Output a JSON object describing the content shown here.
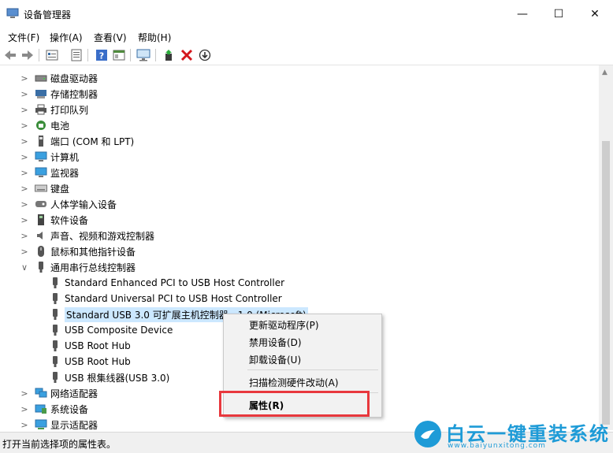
{
  "window": {
    "title": "设备管理器",
    "minimize": "—",
    "maximize": "☐",
    "close": "✕"
  },
  "menu": [
    {
      "label": "文件(F)"
    },
    {
      "label": "操作(A)"
    },
    {
      "label": "查看(V)"
    },
    {
      "label": "帮助(H)"
    }
  ],
  "tree": {
    "top_items": [
      {
        "label": "磁盘驱动器",
        "icon": "disk-icon"
      },
      {
        "label": "存储控制器",
        "icon": "storage-icon"
      },
      {
        "label": "打印队列",
        "icon": "printer-icon"
      },
      {
        "label": "电池",
        "icon": "battery-icon"
      },
      {
        "label": "端口 (COM 和 LPT)",
        "icon": "port-icon"
      },
      {
        "label": "计算机",
        "icon": "computer-icon"
      },
      {
        "label": "监视器",
        "icon": "monitor-icon"
      },
      {
        "label": "键盘",
        "icon": "keyboard-icon"
      },
      {
        "label": "人体学输入设备",
        "icon": "hid-icon"
      },
      {
        "label": "软件设备",
        "icon": "software-icon"
      },
      {
        "label": "声音、视频和游戏控制器",
        "icon": "speaker-icon"
      },
      {
        "label": "鼠标和其他指针设备",
        "icon": "mouse-icon"
      }
    ],
    "usb_group": {
      "label": "通用串行总线控制器",
      "icon": "usb-icon"
    },
    "usb_children": [
      {
        "label": "Standard Enhanced PCI to USB Host Controller"
      },
      {
        "label": "Standard Universal PCI to USB Host Controller"
      },
      {
        "label": "Standard USB 3.0 可扩展主机控制器 - 1.0 (Microsoft)"
      },
      {
        "label": "USB Composite Device"
      },
      {
        "label": "USB Root Hub"
      },
      {
        "label": "USB Root Hub"
      },
      {
        "label": "USB 根集线器(USB 3.0)"
      }
    ],
    "bottom_items": [
      {
        "label": "网络适配器",
        "icon": "network-icon"
      },
      {
        "label": "系统设备",
        "icon": "system-icon"
      },
      {
        "label": "显示适配器",
        "icon": "display-icon"
      }
    ]
  },
  "context_menu": {
    "update": "更新驱动程序(P)",
    "disable": "禁用设备(D)",
    "uninstall": "卸载设备(U)",
    "scan": "扫描检测硬件改动(A)",
    "properties": "属性(R)"
  },
  "status": {
    "text": "打开当前选择项的属性表。"
  },
  "watermark": {
    "brand": "白云一键重装系统",
    "url": "www.baiyunxitong.com"
  },
  "colors": {
    "selection": "#cce8ff",
    "highlight_box": "#e8383d",
    "watermark": "#1e9bd7"
  }
}
